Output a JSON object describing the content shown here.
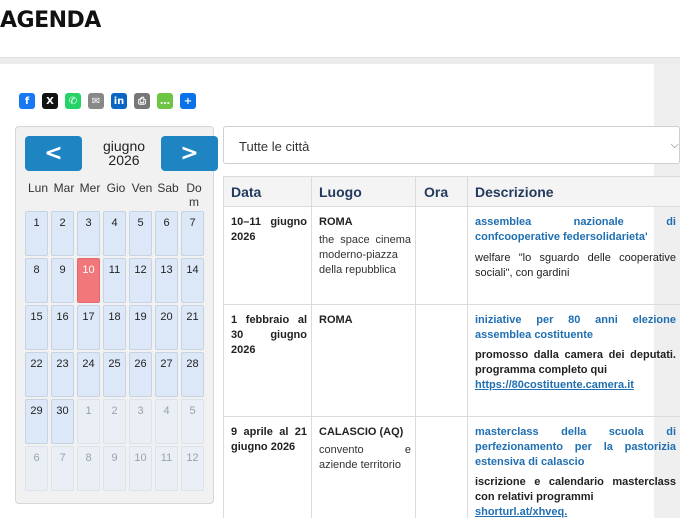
{
  "header": {
    "title": "AGENDA"
  },
  "share": {
    "buttons": [
      {
        "name": "facebook-icon",
        "glyph": "f",
        "color": "#1877f2"
      },
      {
        "name": "x-twitter-icon",
        "glyph": "X",
        "color": "#111111"
      },
      {
        "name": "whatsapp-icon",
        "glyph": "✆",
        "color": "#25d366"
      },
      {
        "name": "email-icon",
        "glyph": "✉",
        "color": "#888888"
      },
      {
        "name": "linkedin-icon",
        "glyph": "in",
        "color": "#0a66c2"
      },
      {
        "name": "print-icon",
        "glyph": "⎙",
        "color": "#777777"
      },
      {
        "name": "sms-icon",
        "glyph": "…",
        "color": "#6cc644"
      },
      {
        "name": "share-plus-icon",
        "glyph": "+",
        "color": "#0a72e8"
      }
    ]
  },
  "calendar": {
    "prev_label": "<",
    "next_label": ">",
    "month": "giugno",
    "year": "2026",
    "weekdays": [
      "Lun",
      "Mar",
      "Mer",
      "Gio",
      "Ven",
      "Sab",
      "Do\nm"
    ],
    "days": [
      {
        "n": "1",
        "state": "current"
      },
      {
        "n": "2",
        "state": "current"
      },
      {
        "n": "3",
        "state": "current"
      },
      {
        "n": "4",
        "state": "current"
      },
      {
        "n": "5",
        "state": "current"
      },
      {
        "n": "6",
        "state": "current"
      },
      {
        "n": "7",
        "state": "current"
      },
      {
        "n": "8",
        "state": "current"
      },
      {
        "n": "9",
        "state": "current"
      },
      {
        "n": "10",
        "state": "today"
      },
      {
        "n": "11",
        "state": "current"
      },
      {
        "n": "12",
        "state": "current"
      },
      {
        "n": "13",
        "state": "current"
      },
      {
        "n": "14",
        "state": "current"
      },
      {
        "n": "15",
        "state": "current"
      },
      {
        "n": "16",
        "state": "current"
      },
      {
        "n": "17",
        "state": "current"
      },
      {
        "n": "18",
        "state": "current"
      },
      {
        "n": "19",
        "state": "current"
      },
      {
        "n": "20",
        "state": "current"
      },
      {
        "n": "21",
        "state": "current"
      },
      {
        "n": "22",
        "state": "current"
      },
      {
        "n": "23",
        "state": "current"
      },
      {
        "n": "24",
        "state": "current"
      },
      {
        "n": "25",
        "state": "current"
      },
      {
        "n": "26",
        "state": "current"
      },
      {
        "n": "27",
        "state": "current"
      },
      {
        "n": "28",
        "state": "current"
      },
      {
        "n": "29",
        "state": "current"
      },
      {
        "n": "30",
        "state": "current"
      },
      {
        "n": "1",
        "state": "other"
      },
      {
        "n": "2",
        "state": "other"
      },
      {
        "n": "3",
        "state": "other"
      },
      {
        "n": "4",
        "state": "other"
      },
      {
        "n": "5",
        "state": "other"
      },
      {
        "n": "6",
        "state": "other"
      },
      {
        "n": "7",
        "state": "other"
      },
      {
        "n": "8",
        "state": "other"
      },
      {
        "n": "9",
        "state": "other"
      },
      {
        "n": "10",
        "state": "other"
      },
      {
        "n": "11",
        "state": "other"
      },
      {
        "n": "12",
        "state": "other"
      }
    ]
  },
  "city_filter": {
    "selected": "Tutte le città"
  },
  "events": {
    "columns": [
      "Data",
      "Luogo",
      "Ora",
      "Descrizione"
    ],
    "rows": [
      {
        "date": "10–11 giugno 2026",
        "city": "ROMA",
        "venue": "the space cinema moderno-piazza della repubblica",
        "time": "",
        "title": "assemblea nazionale di confcooperative federsolidarieta'",
        "desc": "welfare \"lo sguardo delle cooperative sociali\", con gardini",
        "link": ""
      },
      {
        "date": "1 febbraio al 30 giugno 2026",
        "city": "ROMA",
        "venue": "",
        "time": "",
        "title": "iniziative per 80 anni elezione assemblea costituente",
        "desc": "promosso dalla camera dei deputati. programma completo qui",
        "link": "https://80costituente.camera.it"
      },
      {
        "date": "9 aprile al 21 giugno 2026",
        "city": "CALASCIO (AQ)",
        "venue": "convento e aziende territorio",
        "time": "",
        "title": "masterclass della scuola di perfezionamento per la pastorizia estensiva di calascio",
        "desc": "iscrizione e calendario masterclass con relativi programmi",
        "link": "shorturl.at/xhveq."
      }
    ]
  }
}
